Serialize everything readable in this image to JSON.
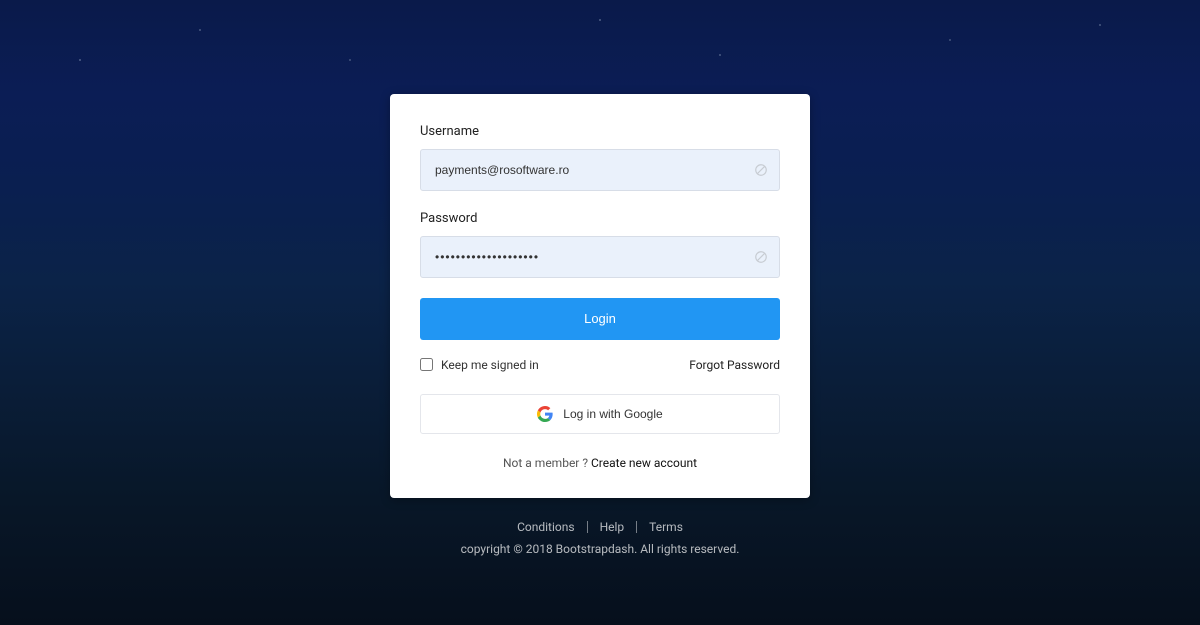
{
  "form": {
    "username_label": "Username",
    "username_value": "payments@rosoftware.ro",
    "password_label": "Password",
    "password_value": "••••••••••••••••••••",
    "login_button": "Login",
    "keep_signed_label": "Keep me signed in",
    "forgot_password": "Forgot Password",
    "google_button": "Log in with Google",
    "signup_prompt": "Not a member ? ",
    "signup_link": "Create new account"
  },
  "footer": {
    "links": [
      "Conditions",
      "Help",
      "Terms"
    ],
    "copyright": "copyright © 2018 Bootstrapdash. All rights reserved."
  }
}
